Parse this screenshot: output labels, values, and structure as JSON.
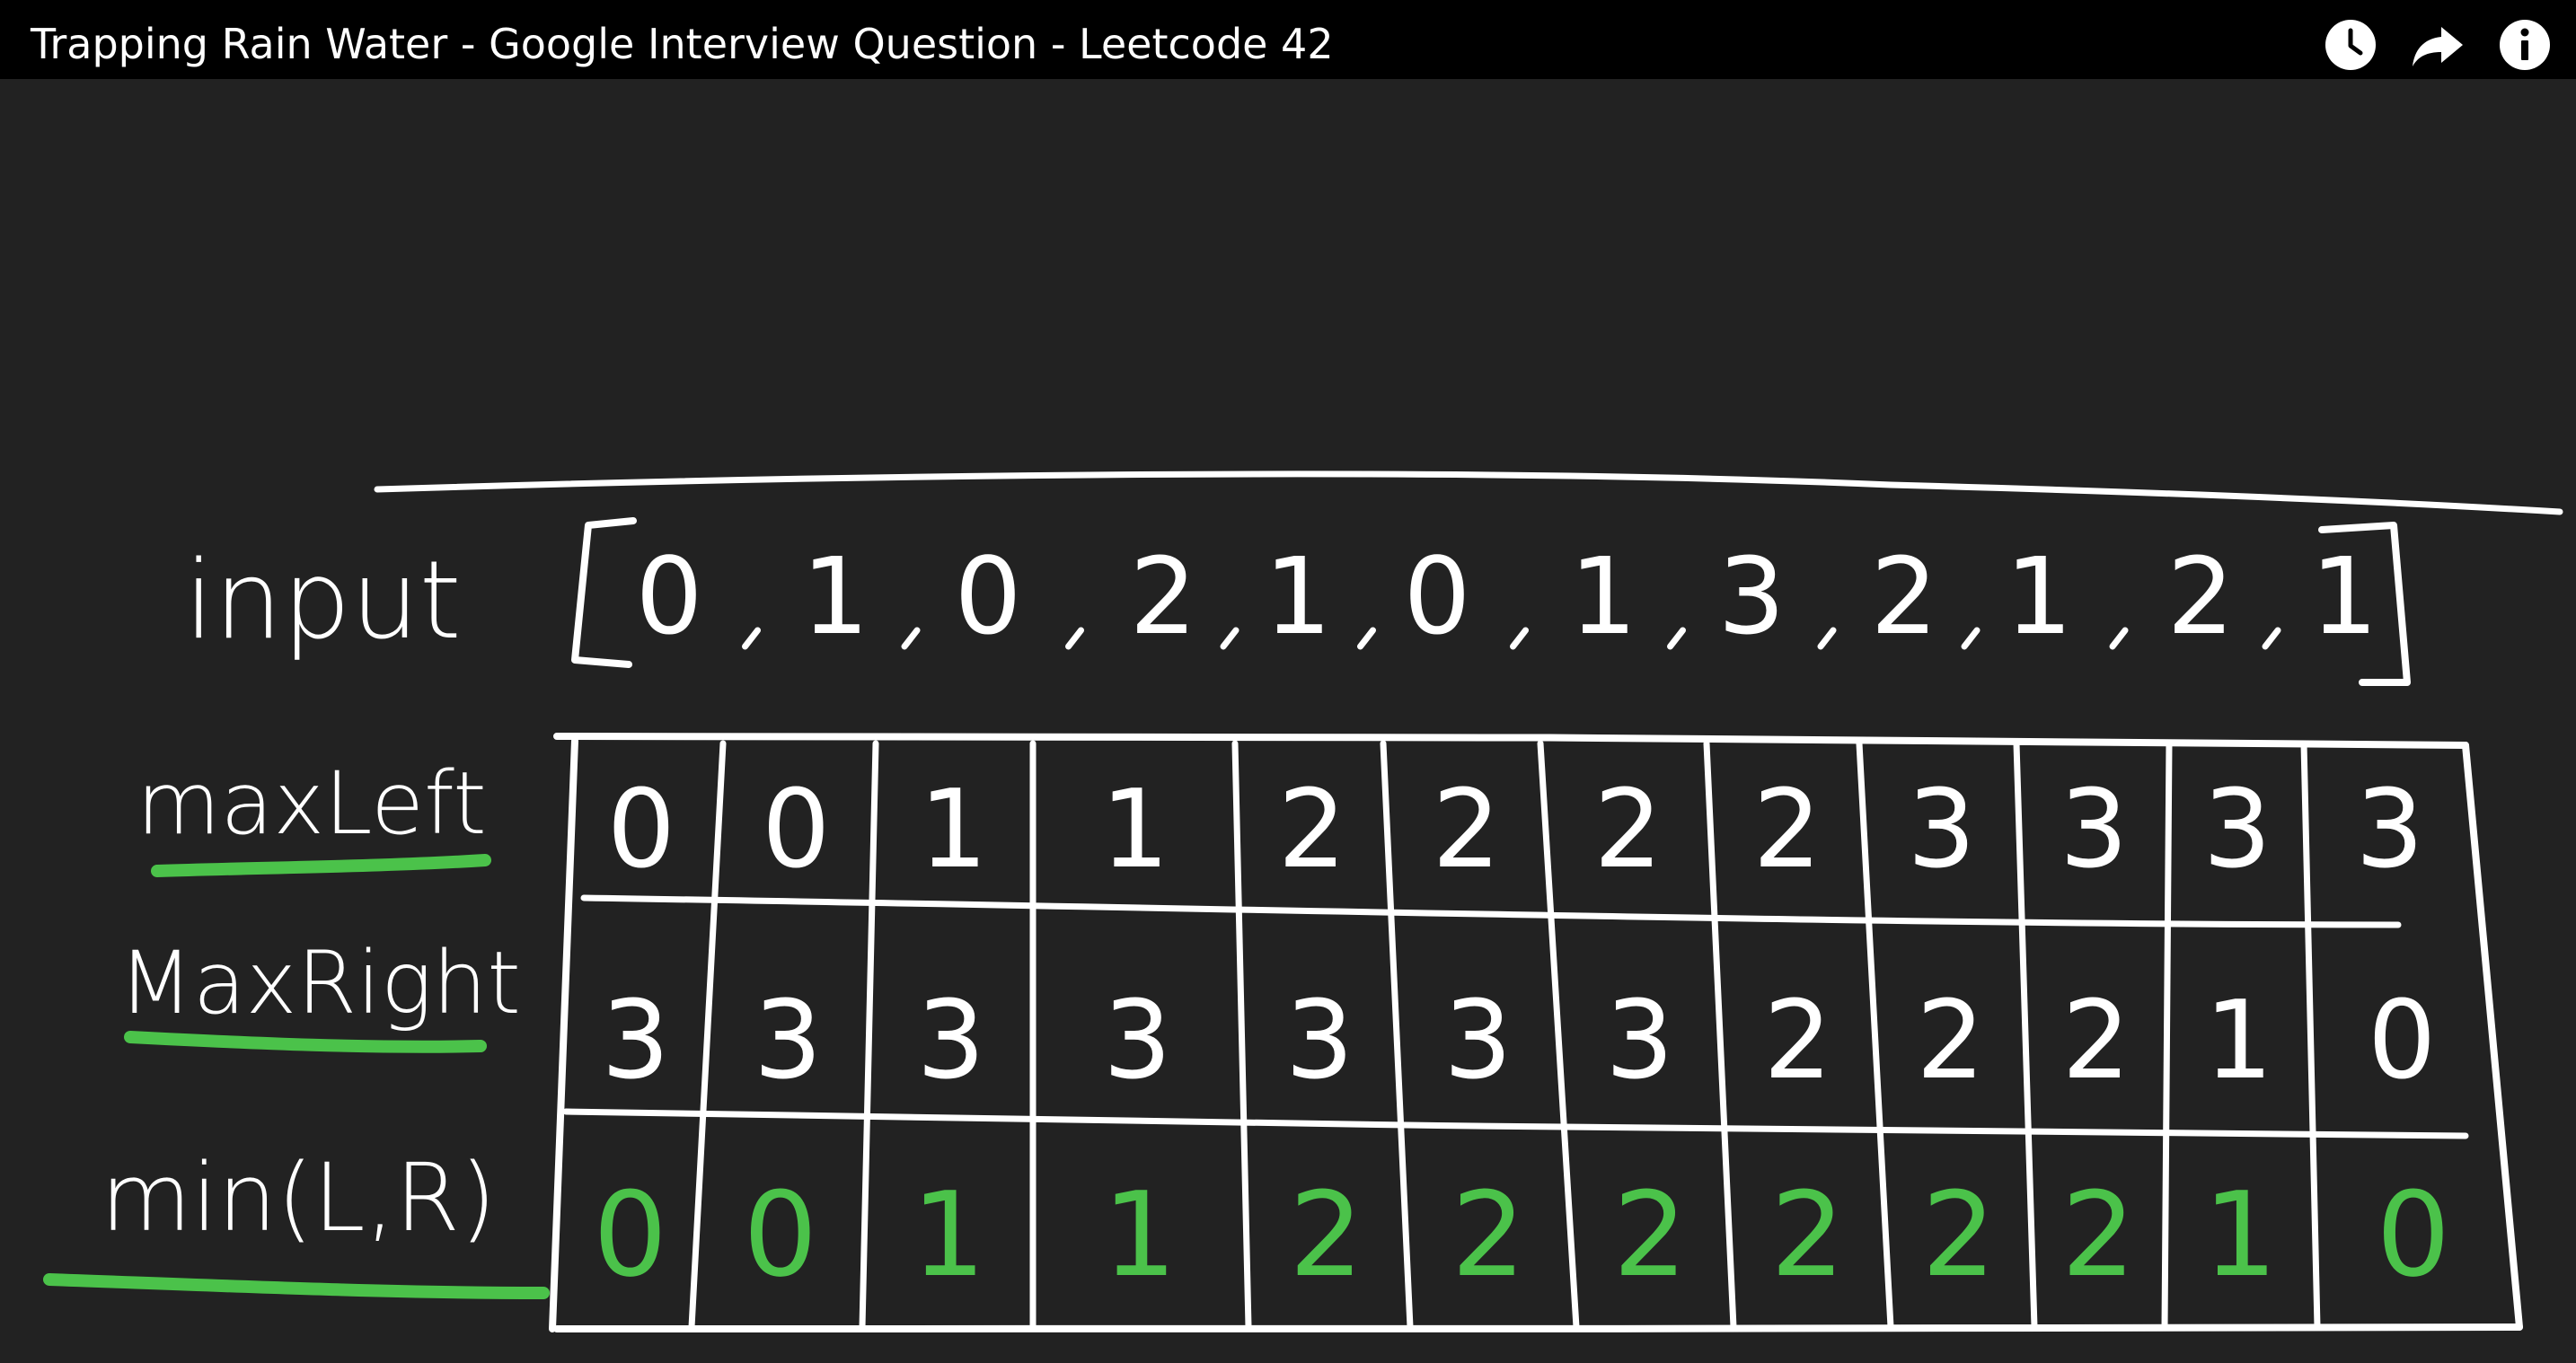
{
  "video": {
    "title": "Trapping Rain Water - Google Interview Question - Leetcode 42"
  },
  "controls": {
    "watch_later_icon": "clock-icon",
    "share_icon": "share-arrow-icon",
    "info_icon": "info-icon"
  },
  "board": {
    "input_label": "input",
    "input_values": [
      "0",
      "1",
      "0",
      "2",
      "1",
      "0",
      "1",
      "3",
      "2",
      "1",
      "2",
      "1"
    ],
    "max_left_label": "maxLeft",
    "max_left": [
      "0",
      "0",
      "1",
      "1",
      "2",
      "2",
      "2",
      "2",
      "3",
      "3",
      "3",
      "3"
    ],
    "max_right_label": "MaxRight",
    "max_right": [
      "3",
      "3",
      "3",
      "3",
      "3",
      "3",
      "3",
      "2",
      "2",
      "2",
      "1",
      "0"
    ],
    "min_label": "min(L,R)",
    "min_lr": [
      "0",
      "0",
      "1",
      "1",
      "2",
      "2",
      "2",
      "2",
      "2",
      "2",
      "1",
      "0"
    ],
    "colors": {
      "chalk": "#ffffff",
      "highlight": "#4bc24a",
      "background": "#222222"
    }
  }
}
